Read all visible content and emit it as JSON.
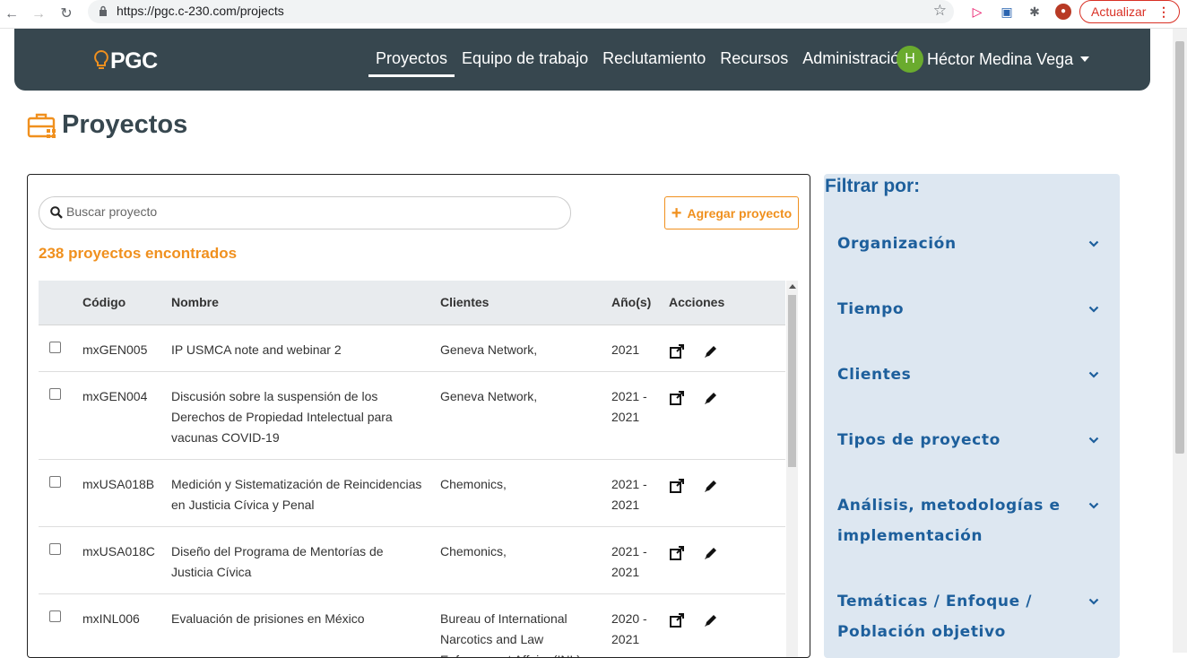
{
  "browser": {
    "url": "https://pgc.c-230.com/projects",
    "update_label": "Actualizar"
  },
  "navbar": {
    "logo": "PGC",
    "links": [
      "Proyectos",
      "Equipo de trabajo",
      "Reclutamiento",
      "Recursos",
      "Administración"
    ],
    "active": "Proyectos",
    "user_initial": "H",
    "user_name": "Héctor Medina Vega"
  },
  "page": {
    "title": "Proyectos"
  },
  "search": {
    "placeholder": "Buscar proyecto"
  },
  "add_button": "Agregar proyecto",
  "results_count": "238 proyectos encontrados",
  "table": {
    "headers": [
      "Código",
      "Nombre",
      "Clientes",
      "Año(s)",
      "Acciones"
    ],
    "rows": [
      {
        "code": "mxGEN005",
        "name": "IP USMCA note and webinar 2",
        "clients": "Geneva Network,",
        "years": "2021"
      },
      {
        "code": "mxGEN004",
        "name": "Discusión sobre la suspensión de los Derechos de Propiedad Intelectual para vacunas COVID-19",
        "clients": "Geneva Network,",
        "years": "2021 - 2021"
      },
      {
        "code": "mxUSA018B",
        "name": "Medición y Sistematización de Reincidencias en Justicia Cívica y Penal",
        "clients": "Chemonics,",
        "years": "2021 - 2021"
      },
      {
        "code": "mxUSA018C",
        "name": "Diseño del Programa de Mentorías de Justicia Cívica",
        "clients": "Chemonics,",
        "years": "2021 - 2021"
      },
      {
        "code": "mxINL006",
        "name": "Evaluación de prisiones en México",
        "clients": "Bureau of International Narcotics and Law Enforcement Affairs (INL),",
        "years": "2020 - 2021"
      }
    ]
  },
  "filters": {
    "title": "Filtrar por:",
    "items": [
      "Organización",
      "Tiempo",
      "Clientes",
      "Tipos de proyecto",
      "Análisis, metodologías e implementación",
      "Temáticas / Enfoque / Población objetivo"
    ]
  },
  "colors": {
    "navbar": "#37474f",
    "accent": "#f0901e",
    "filter_bg": "#dde7f1",
    "filter_text": "#1d5f9c"
  }
}
